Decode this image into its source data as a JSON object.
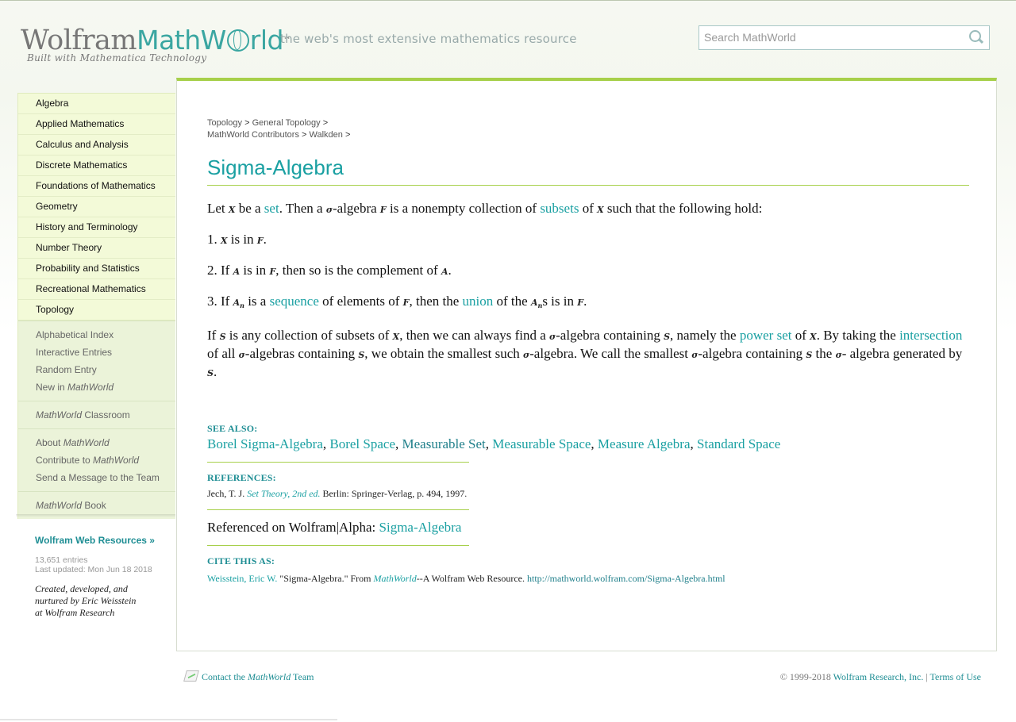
{
  "header": {
    "logo_wolfram": "Wolfram",
    "logo_mathworld": "MathW",
    "logo_mathworld_end": "rld",
    "logo_tm": "™",
    "tagline": "the web's most extensive mathematics resource",
    "built_with": "Built with Mathematica Technology",
    "search_placeholder": "Search MathWorld"
  },
  "sidebar": {
    "main_items": [
      "Algebra",
      "Applied Mathematics",
      "Calculus and Analysis",
      "Discrete Mathematics",
      "Foundations of Mathematics",
      "Geometry",
      "History and Terminology",
      "Number Theory",
      "Probability and Statistics",
      "Recreational Mathematics",
      "Topology"
    ],
    "alphabetical_index": "Alphabetical Index",
    "interactive_entries": "Interactive Entries",
    "random_entry": "Random Entry",
    "new_in": "New in ",
    "mathworld": "MathWorld",
    "classroom": " Classroom",
    "about": "About ",
    "contribute_to": "Contribute to ",
    "send_message": "Send a Message to the Team",
    "book": " Book",
    "web_resources": "Wolfram Web Resources »",
    "entries": "13,651 entries",
    "last_updated": "Last updated: Mon Jun 18 2018",
    "credit_line1": "Created, developed, and",
    "credit_line2": "nurtured by Eric Weisstein",
    "credit_line3": "at Wolfram Research"
  },
  "breadcrumb": {
    "topology": "Topology",
    "general_topology": "General Topology",
    "contributors": "MathWorld Contributors",
    "walkden": "Walkden",
    "sep": ">"
  },
  "article": {
    "title": "Sigma-Algebra",
    "p1": {
      "let": "Let ",
      "X": "X",
      "be_a": " be a ",
      "set": "set",
      "then_a": ". Then a ",
      "sigma": "σ",
      "algebra": "-algebra ",
      "F": "F",
      "nonempty": " is a nonempty collection of ",
      "subsets": "subsets",
      "of": " of ",
      "hold": " such that the following hold:"
    },
    "item1": {
      "num": "1. ",
      "X": "X",
      "is_in": " is in ",
      "F": "F",
      "end": "."
    },
    "item2": {
      "num": "2. If ",
      "A": "A",
      "is_in": " is in ",
      "F": "F",
      "complement": ", then so is the complement of ",
      "end": "."
    },
    "item3": {
      "num": "3. If ",
      "An": "A",
      "n": "n",
      "is_a": " is a ",
      "sequence": "sequence",
      "of_elements": " of elements of ",
      "F": "F",
      "then_the": ", then the ",
      "union": "union",
      "of_the": " of the ",
      "s_is_in": "s is in ",
      "end": "."
    },
    "p2": {
      "if": "If ",
      "S": "S",
      "is_any": " is any collection of subsets of ",
      "X": "X",
      "can_find": ", then we can always find a ",
      "sigma": "σ",
      "containing": "-algebra containing ",
      "namely": ", namely the ",
      "power_set": "power set",
      "of": " of ",
      "by_taking": ". By taking the ",
      "intersection": "intersection",
      "of_all": " of all ",
      "algebras_containing": "-algebras containing ",
      "smallest": ", we obtain the smallest such ",
      "we_call": "-algebra. We call the smallest ",
      "the": " the ",
      "dash": "-",
      "generated_by": "algebra generated by ",
      "end": "."
    }
  },
  "see_also": {
    "heading": "SEE ALSO:",
    "links": [
      "Borel Sigma-Algebra",
      "Borel Space",
      "Measurable Set",
      "Measurable Space",
      "Measure Algebra",
      "Standard Space"
    ],
    "comma": ", "
  },
  "references": {
    "heading": "REFERENCES:",
    "author": "Jech, T. J. ",
    "book": "Set Theory, 2nd ed.",
    "rest": " Berlin: Springer-Verlag, p. 494, 1997."
  },
  "alpha": {
    "label": "Referenced on Wolfram|Alpha: ",
    "link": "Sigma-Algebra"
  },
  "cite": {
    "heading": "CITE THIS AS:",
    "author": "Weisstein, Eric W.",
    "quote": " \"Sigma-Algebra.\" From ",
    "mathworld": "MathWorld",
    "resource": "--A Wolfram Web Resource. ",
    "url": "http://mathworld.wolfram.com/Sigma-Algebra.html"
  },
  "footer": {
    "contact_the": "Contact the ",
    "mathworld": "MathWorld",
    "team": " Team",
    "copyright": "© 1999-2018 ",
    "wolfram": "Wolfram Research, Inc.",
    "sep": " | ",
    "terms": "Terms of Use"
  }
}
